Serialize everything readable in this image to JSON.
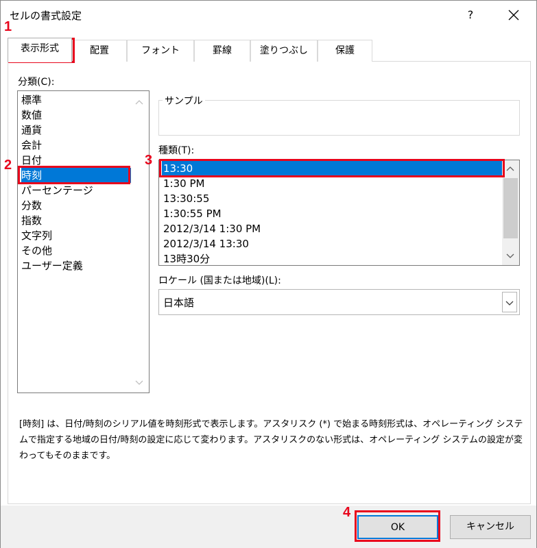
{
  "window": {
    "title": "セルの書式設定",
    "help_label": "?"
  },
  "tabs": [
    {
      "label": "表示形式"
    },
    {
      "label": "配置"
    },
    {
      "label": "フォント"
    },
    {
      "label": "罫線"
    },
    {
      "label": "塗りつぶし"
    },
    {
      "label": "保護"
    }
  ],
  "category": {
    "label": "分類(C):",
    "items": [
      "標準",
      "数値",
      "通貨",
      "会計",
      "日付",
      "時刻",
      "パーセンテージ",
      "分数",
      "指数",
      "文字列",
      "その他",
      "ユーザー定義"
    ],
    "selected": "時刻"
  },
  "sample": {
    "label": "サンプル",
    "value": ""
  },
  "type": {
    "label": "種類(T):",
    "items": [
      "13:30",
      "1:30 PM",
      "13:30:55",
      "1:30:55 PM",
      "2012/3/14 1:30 PM",
      "2012/3/14 13:30",
      "13時30分"
    ],
    "selected": "13:30"
  },
  "locale": {
    "label": "ロケール (国または地域)(L):",
    "value": "日本語"
  },
  "description": "[時刻] は、日付/時刻のシリアル値を時刻形式で表示します。アスタリスク (*) で始まる時刻形式は、オペレーティング システムで指定する地域の日付/時刻の設定に応じて変わります。アスタリスクのない形式は、オペレーティング システムの設定が変わってもそのままです。",
  "buttons": {
    "ok": "OK",
    "cancel": "キャンセル"
  },
  "annotations": [
    "1",
    "2",
    "3",
    "4"
  ],
  "colors": {
    "selection": "#0078d7",
    "annotation": "#e8051c"
  },
  "icons": [
    "close-icon",
    "chevron-down-icon",
    "chevron-up-icon"
  ]
}
